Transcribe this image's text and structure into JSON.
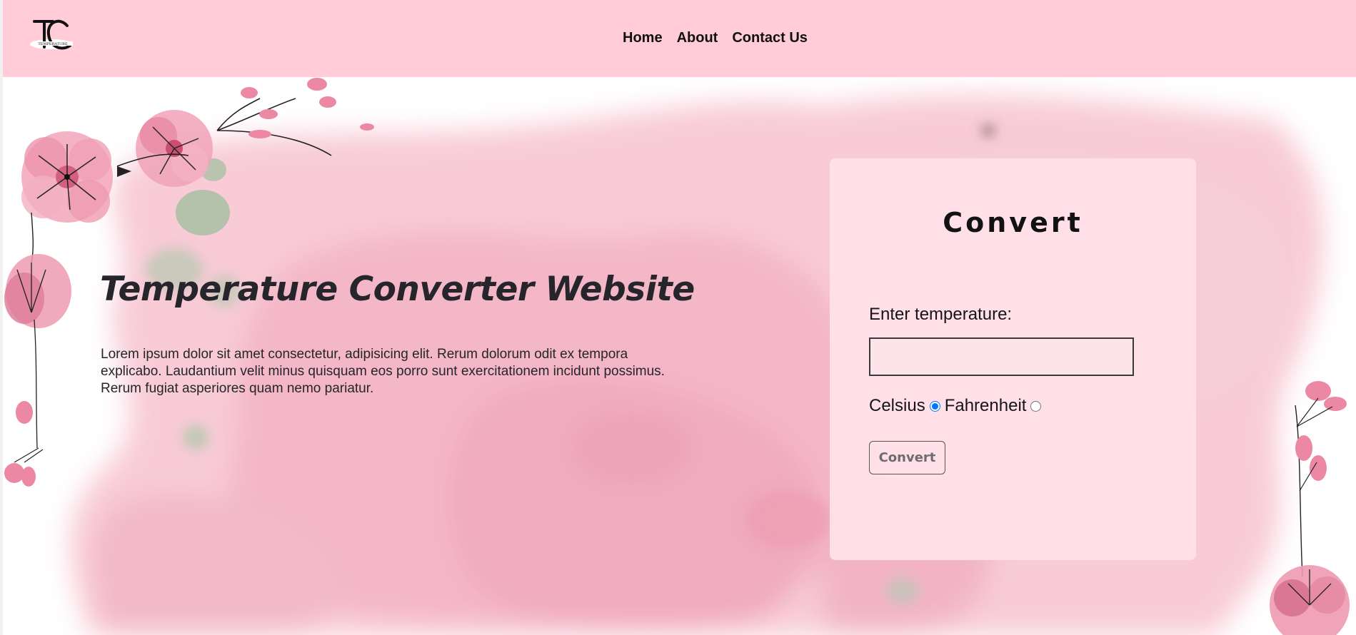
{
  "header": {
    "logo_text": "TEMPERATURE",
    "nav": [
      {
        "label": "Home"
      },
      {
        "label": "About"
      },
      {
        "label": "Contact Us"
      }
    ]
  },
  "hero": {
    "title": "Temperature Converter Website",
    "description": "Lorem ipsum dolor sit amet consectetur, adipisicing elit. Rerum dolorum odit ex tempora explicabo. Laudantium velit minus quisquam eos porro sunt exercitationem incidunt possimus. Rerum fugiat asperiores quam nemo pariatur."
  },
  "converter": {
    "title": "Convert",
    "input_label": "Enter temperature:",
    "input_value": "",
    "units": [
      {
        "label": "Celsius",
        "checked": true
      },
      {
        "label": "Fahrenheit",
        "checked": false
      }
    ],
    "button_label": "Convert"
  },
  "colors": {
    "header_bg": "#ffccd8",
    "card_bg": "#ffe0e8",
    "watercolor": "#f4a9bd",
    "text": "#25252b"
  }
}
